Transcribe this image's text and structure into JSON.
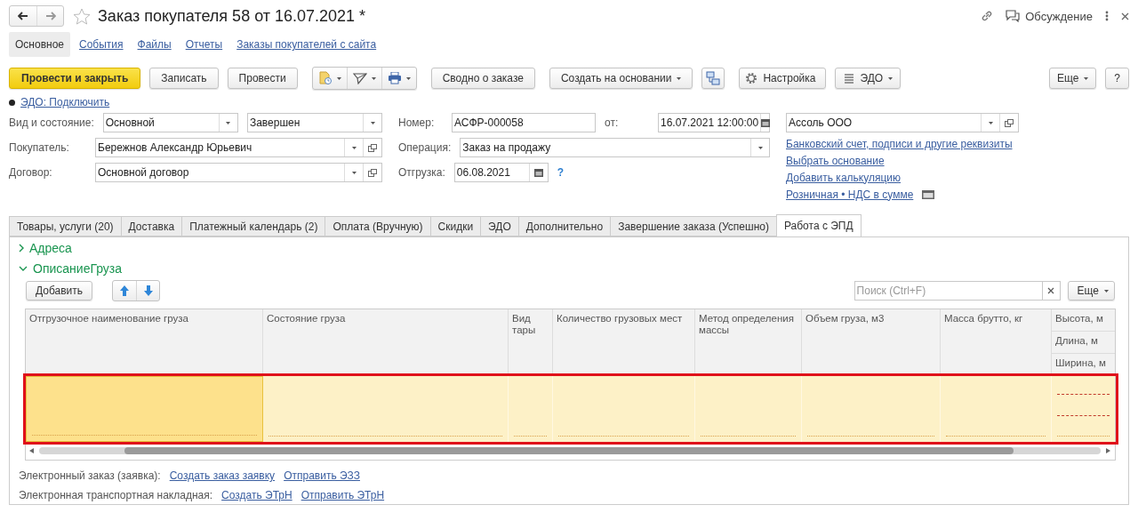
{
  "window": {
    "title": "Заказ покупателя 58 от 16.07.2021 *",
    "discussion": "Обсуждение",
    "favorite": false
  },
  "nav": [
    {
      "label": "Основное",
      "selected": true
    },
    {
      "label": "События",
      "selected": false
    },
    {
      "label": "Файлы",
      "selected": false
    },
    {
      "label": "Отчеты",
      "selected": false
    },
    {
      "label": "Заказы покупателей с сайта",
      "selected": false
    }
  ],
  "toolbar": [
    {
      "kind": "primary",
      "label": "Провести и закрыть"
    },
    {
      "kind": "plain",
      "label": "Записать"
    },
    {
      "kind": "plain",
      "label": "Провести"
    },
    {
      "kind": "icon_group"
    },
    {
      "kind": "plain",
      "label": "Сводно о заказе"
    },
    {
      "kind": "menu",
      "label": "Создать на основании"
    },
    {
      "kind": "structure"
    },
    {
      "kind": "settings",
      "label": "Настройка"
    },
    {
      "kind": "edo",
      "label": "ЭДО"
    },
    {
      "kind": "menu",
      "label": "Еще"
    },
    {
      "kind": "help",
      "label": "?"
    }
  ],
  "edo_link": "ЭДО: Подключить",
  "form": {
    "left": [
      {
        "label": "Вид и состояние:",
        "fields": [
          {
            "kind": "select",
            "value": "Основной"
          },
          {
            "kind": "select",
            "value": "Завершен"
          }
        ]
      },
      {
        "label": "Покупатель:",
        "fields": [
          {
            "kind": "select_open",
            "value": "Бережнов Александр Юрьевич"
          }
        ]
      },
      {
        "label": "Договор:",
        "fields": [
          {
            "kind": "select_open",
            "value": "Основной договор"
          }
        ]
      }
    ],
    "middle": [
      {
        "label": "Номер:",
        "fields": [
          {
            "kind": "text",
            "value": "АСФР-000058"
          },
          {
            "kind": "date",
            "prefix": "от:",
            "value": "16.07.2021 12:00:00"
          }
        ]
      },
      {
        "label": "Операция:",
        "fields": [
          {
            "kind": "select",
            "value": "Заказ на продажу"
          }
        ]
      },
      {
        "label": "Отгрузка:",
        "fields": [
          {
            "kind": "date",
            "value": "06.08.2021"
          }
        ],
        "help": "?"
      }
    ],
    "right": {
      "field": {
        "kind": "select_open",
        "value": "Ассоль ООО"
      },
      "links": [
        {
          "kind": "plain",
          "text": "Банковский счет, подписи и другие реквизиты"
        },
        {
          "kind": "plain",
          "text": "Выбрать основание"
        },
        {
          "kind": "plain",
          "text": "Добавить калькуляцию"
        },
        {
          "kind": "with_icon",
          "text": "Розничная • НДС в сумме"
        }
      ]
    }
  },
  "tabs": [
    {
      "label": "Товары, услуги (20)",
      "selected": false
    },
    {
      "label": "Доставка",
      "selected": false
    },
    {
      "label": "Платежный календарь (2)",
      "selected": false
    },
    {
      "label": "Оплата (Вручную)",
      "selected": false
    },
    {
      "label": "Скидки",
      "selected": false
    },
    {
      "label": "ЭДО",
      "selected": false
    },
    {
      "label": "Дополнительно",
      "selected": false
    },
    {
      "label": "Завершение заказа (Успешно)",
      "selected": false
    },
    {
      "label": "Работа с ЭПД",
      "selected": true
    }
  ],
  "groups": [
    {
      "title": "Адреса",
      "expanded": false
    },
    {
      "title": "ОписаниеГруза",
      "expanded": true
    }
  ],
  "table_toolbar": {
    "add": "Добавить",
    "search": {
      "placeholder": "Поиск (Ctrl+F)"
    },
    "more": "Еще"
  },
  "table": {
    "columns": [
      "Отгрузочное наименование груза",
      "Состояние груза",
      "Вид тары",
      "Количество грузовых мест",
      "Метод определения массы",
      "Объем груза, м3",
      "Масса брутто, кг"
    ],
    "stacked_columns": [
      "Высота, м",
      "Длина, м",
      "Ширина, м"
    ],
    "rows": [
      {
        "selected": true,
        "highlighted": true,
        "cells": [
          {
            "current": true
          },
          {
            "current": false
          },
          {
            "current": false
          },
          {
            "current": false
          },
          {
            "current": false
          },
          {
            "current": false
          },
          {
            "current": false
          }
        ],
        "stacked_cells": [
          {
            "required": true
          },
          {
            "required": true
          },
          {
            "required": false
          }
        ]
      }
    ]
  },
  "footer": [
    {
      "label": "Электронный заказ (заявка):",
      "links": [
        "Создать заказ заявку",
        "Отправить ЭЗЗ"
      ]
    },
    {
      "label": "Электронная транспортная накладная:",
      "links": [
        "Создать ЭТрН",
        "Отправить ЭТрН"
      ]
    }
  ]
}
